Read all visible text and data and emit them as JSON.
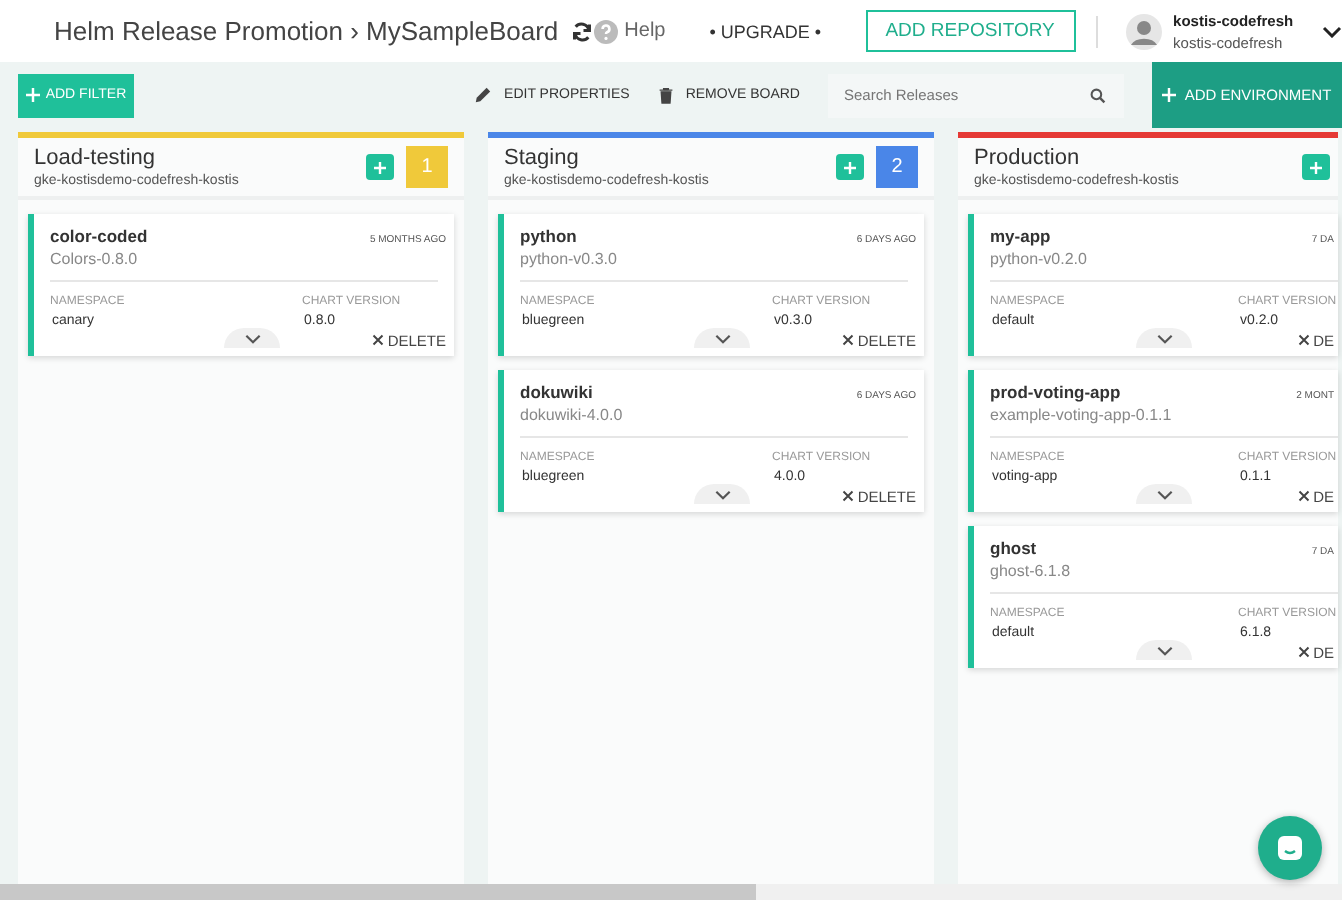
{
  "header": {
    "title": "Helm Release Promotion › MySampleBoard",
    "help": "Help",
    "upgrade": "• UPGRADE •",
    "add_repository": "ADD REPOSITORY",
    "user": {
      "name": "kostis-codefresh",
      "account": "kostis-codefresh"
    }
  },
  "toolbar": {
    "add_filter": "ADD FILTER",
    "edit_properties": "EDIT PROPERTIES",
    "remove_board": "REMOVE BOARD",
    "search": {
      "placeholder": "Search Releases"
    },
    "add_environment": "ADD ENVIRONMENT"
  },
  "columns": [
    {
      "name": "Load-testing",
      "cluster": "gke-kostisdemo-codefresh-kostis",
      "color": "#f0c93a",
      "count": "1",
      "releases": [
        {
          "name": "color-coded",
          "chart": "Colors-0.8.0",
          "time": "5 MONTHS AGO",
          "namespace_label": "NAMESPACE",
          "namespace": "canary",
          "version_label": "CHART VERSION",
          "version": "0.8.0",
          "delete": "DELETE"
        }
      ]
    },
    {
      "name": "Staging",
      "cluster": "gke-kostisdemo-codefresh-kostis",
      "color": "#4a86e8",
      "count": "2",
      "releases": [
        {
          "name": "python",
          "chart": "python-v0.3.0",
          "time": "6 DAYS AGO",
          "namespace_label": "NAMESPACE",
          "namespace": "bluegreen",
          "version_label": "CHART VERSION",
          "version": "v0.3.0",
          "delete": "DELETE"
        },
        {
          "name": "dokuwiki",
          "chart": "dokuwiki-4.0.0",
          "time": "6 DAYS AGO",
          "namespace_label": "NAMESPACE",
          "namespace": "bluegreen",
          "version_label": "CHART VERSION",
          "version": "4.0.0",
          "delete": "DELETE"
        }
      ]
    },
    {
      "name": "Production",
      "cluster": "gke-kostisdemo-codefresh-kostis",
      "color": "#e53935",
      "releases": [
        {
          "name": "my-app",
          "chart": "python-v0.2.0",
          "time": "7 DA",
          "namespace_label": "NAMESPACE",
          "namespace": "default",
          "version_label": "CHART VERSION",
          "version": "v0.2.0",
          "delete": "DE"
        },
        {
          "name": "prod-voting-app",
          "chart": "example-voting-app-0.1.1",
          "time": "2 MONT",
          "namespace_label": "NAMESPACE",
          "namespace": "voting-app",
          "version_label": "CHART VERSION",
          "version": "0.1.1",
          "delete": "DE"
        },
        {
          "name": "ghost",
          "chart": "ghost-6.1.8",
          "time": "7 DA",
          "namespace_label": "NAMESPACE",
          "namespace": "default",
          "version_label": "CHART VERSION",
          "version": "6.1.8",
          "delete": "DE"
        }
      ]
    }
  ]
}
